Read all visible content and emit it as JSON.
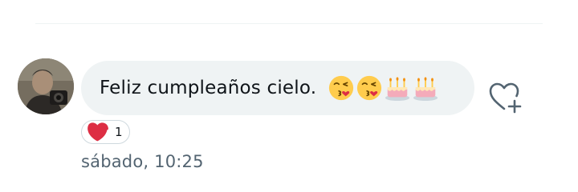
{
  "message": {
    "text": "Feliz cumpleaños cielo.",
    "emojis": [
      "kissing-face-emoji",
      "kissing-face-emoji",
      "birthday-cake-emoji",
      "birthday-cake-emoji"
    ]
  },
  "reaction": {
    "icon": "red-heart-emoji",
    "count": "1"
  },
  "timestamp": "sábado, 10:25",
  "colors": {
    "bubble": "#eff3f4",
    "text": "#0f1419",
    "muted": "#536471",
    "heart": "#e8283b"
  }
}
